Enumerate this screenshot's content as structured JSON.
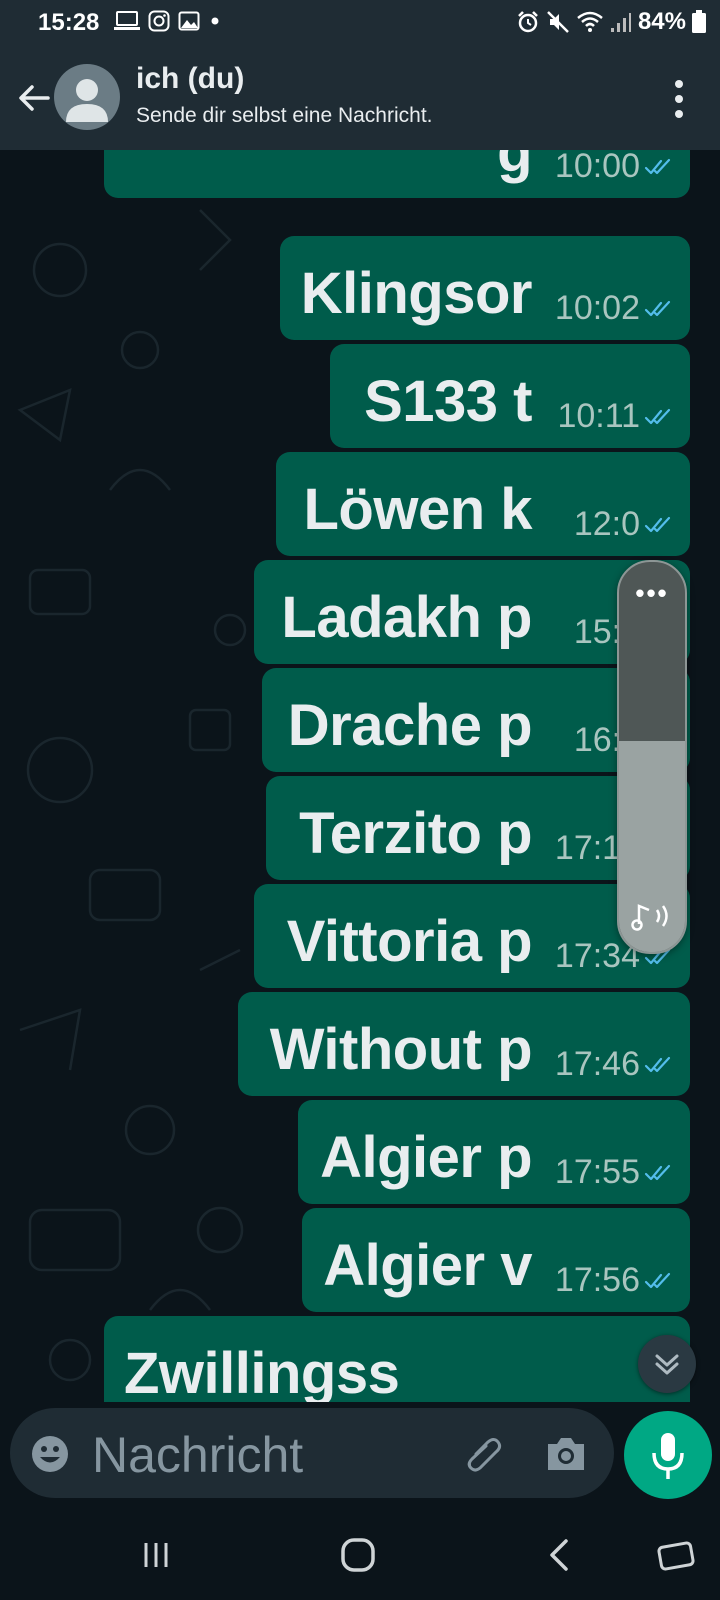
{
  "status_bar": {
    "time": "15:28",
    "battery": "84%",
    "left_icons": [
      "laptop-icon",
      "instagram-icon",
      "image-icon",
      "dot-icon"
    ],
    "right_icons": [
      "alarm-icon",
      "mute-icon",
      "wifi-icon",
      "signal-icon",
      "battery-icon"
    ]
  },
  "header": {
    "title": "ich (du)",
    "subtitle": "Sende dir selbst eine Nachricht."
  },
  "messages": [
    {
      "text": "g",
      "time": "10:00"
    },
    {
      "text": "Klingsor",
      "time": "10:02"
    },
    {
      "text": "S133 t",
      "time": "10:11"
    },
    {
      "text": "Löwen k",
      "time": "12:0"
    },
    {
      "text": "Ladakh p",
      "time": "15:1"
    },
    {
      "text": "Drache p",
      "time": "16:5"
    },
    {
      "text": "Terzito p",
      "time": "17:15"
    },
    {
      "text": "Vittoria p",
      "time": "17:34"
    },
    {
      "text": "Without p",
      "time": "17:46"
    },
    {
      "text": "Algier p",
      "time": "17:55"
    },
    {
      "text": "Algier v",
      "time": "17:56"
    },
    {
      "text": "Zwillingss",
      "time": ""
    }
  ],
  "volume_overlay": {
    "menu_label": "•••",
    "level": 0.54
  },
  "input": {
    "placeholder": "Nachricht"
  },
  "colors": {
    "bubble_out": "#005c4b",
    "chat_bg": "#0b141a",
    "header_bg": "#1f2c34",
    "accent": "#00a884",
    "read_ticks": "#53bdeb"
  }
}
